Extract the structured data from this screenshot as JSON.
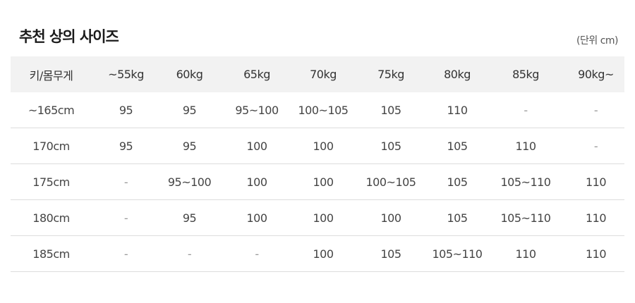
{
  "title": "추천 상의 사이즈",
  "unit_note": "(단위 cm)",
  "table": {
    "headers": [
      "키/몸무게",
      "~55kg",
      "60kg",
      "65kg",
      "70kg",
      "75kg",
      "80kg",
      "85kg",
      "90kg~"
    ],
    "rows": [
      [
        "~165cm",
        "95",
        "95",
        "95~100",
        "100~105",
        "105",
        "110",
        "-",
        "-"
      ],
      [
        "170cm",
        "95",
        "95",
        "100",
        "100",
        "105",
        "105",
        "110",
        "-"
      ],
      [
        "175cm",
        "-",
        "95~100",
        "100",
        "100",
        "100~105",
        "105",
        "105~110",
        "110"
      ],
      [
        "180cm",
        "-",
        "95",
        "100",
        "100",
        "100",
        "105",
        "105~110",
        "110"
      ],
      [
        "185cm",
        "-",
        "-",
        "-",
        "100",
        "105",
        "105~110",
        "110",
        "110"
      ]
    ]
  }
}
